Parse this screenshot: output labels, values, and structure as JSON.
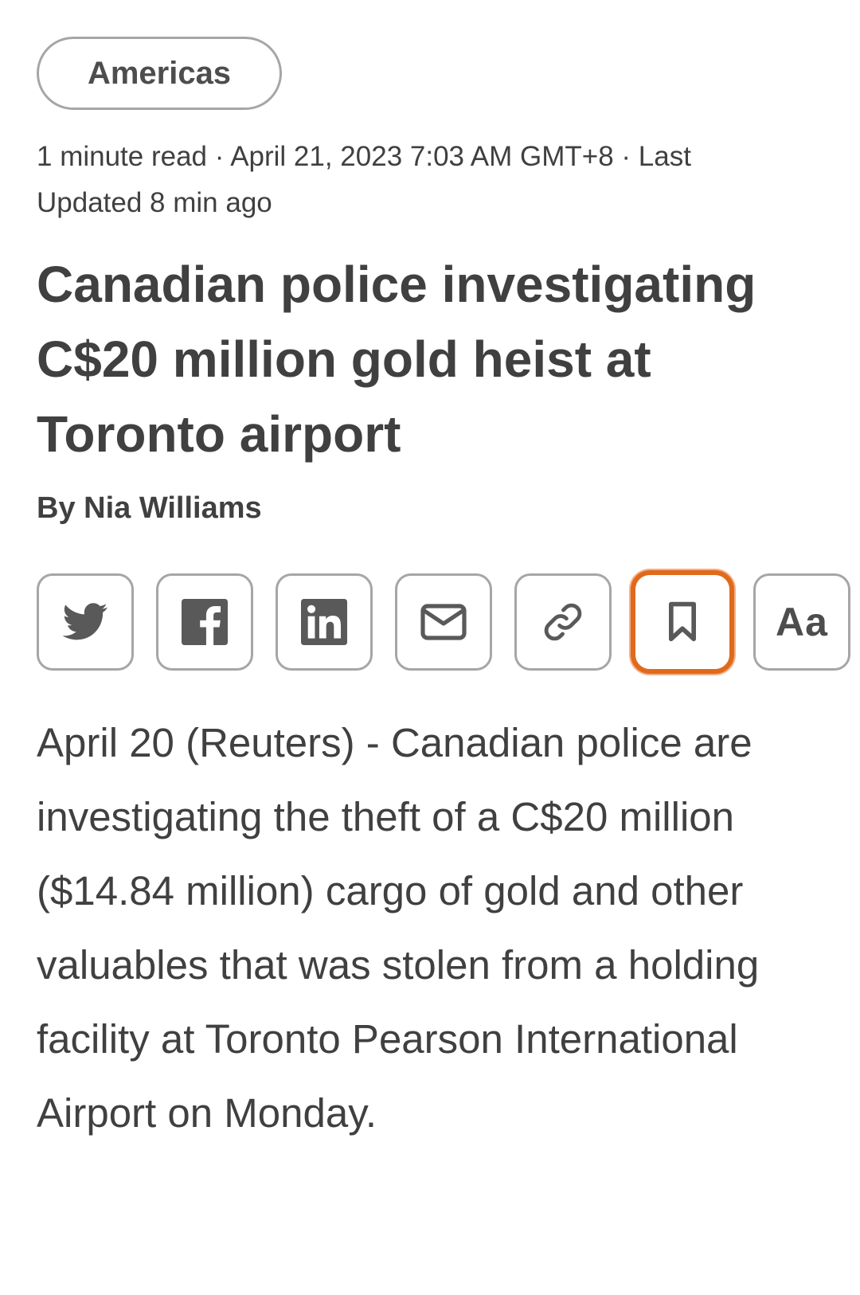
{
  "category": {
    "label": "Americas"
  },
  "meta": {
    "text": "1 minute read · April 21, 2023 7:03 AM GMT+8 · Last Updated 8 min ago"
  },
  "headline": "Canadian police investigating C$20 million gold heist at Toronto airport",
  "byline": "By Nia Williams",
  "share": {
    "buttons": [
      {
        "name": "twitter",
        "icon": "twitter-icon"
      },
      {
        "name": "facebook",
        "icon": "facebook-icon"
      },
      {
        "name": "linkedin",
        "icon": "linkedin-icon"
      },
      {
        "name": "email",
        "icon": "mail-icon"
      },
      {
        "name": "copy-link",
        "icon": "link-icon"
      },
      {
        "name": "bookmark",
        "icon": "bookmark-icon",
        "focused": true
      },
      {
        "name": "text-size",
        "icon": "text-size-icon",
        "label": "Aa"
      }
    ],
    "focus_color": "#e06a1b"
  },
  "body": {
    "paragraph": "April 20 (Reuters) - Canadian police are investigating the theft of a C$20 million ($14.84 million) cargo of gold and other valuables that was stolen from a holding facility at Toronto Pearson International Airport on Monday."
  }
}
